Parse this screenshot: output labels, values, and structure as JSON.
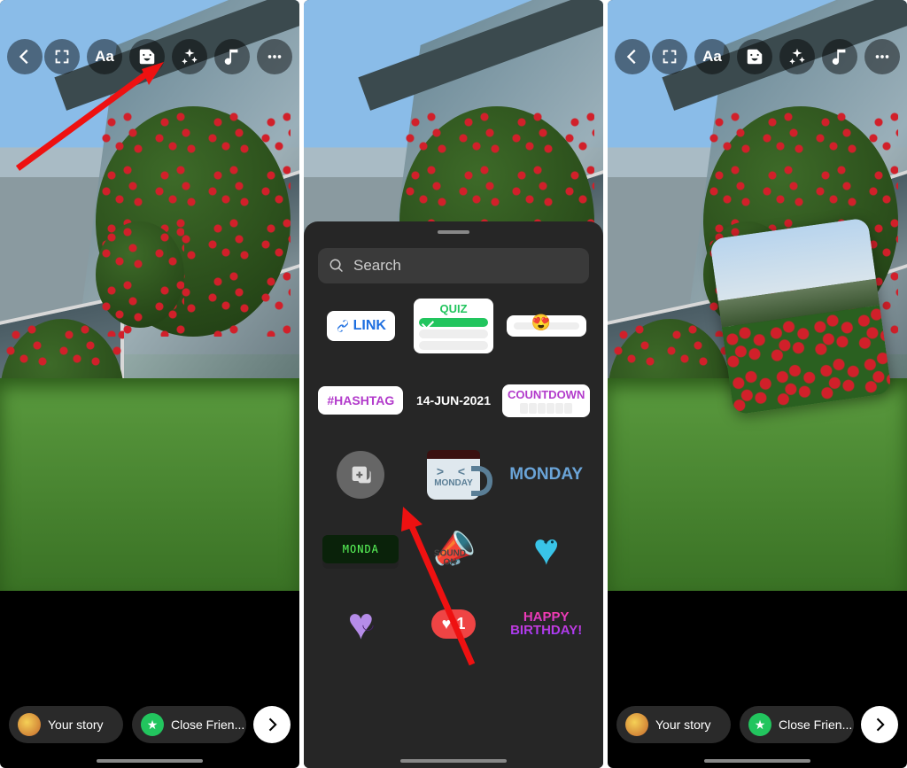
{
  "toolbar": {
    "text_label": "Aa"
  },
  "bottom": {
    "your_story": "Your story",
    "close_friends": "Close Frien..."
  },
  "sheet": {
    "search_placeholder": "Search",
    "link": "LINK",
    "quiz": "QUIZ",
    "hashtag": "#HASHTAG",
    "date": "14-JUN-2021",
    "countdown": "COUNTDOWN",
    "mug_label": "MONDAY",
    "monday": "MONDAY",
    "clock": "MONDA",
    "sound_on_1": "SOUND",
    "sound_on_2": "ON",
    "like_count": "1",
    "happy_1": "HAPPY",
    "happy_2": "BIRTHDAY!"
  }
}
